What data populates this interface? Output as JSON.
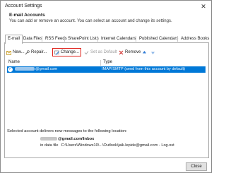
{
  "window": {
    "title": "Account Settings",
    "close_glyph": "✕"
  },
  "header": {
    "title": "E-mail Accounts",
    "description": "You can add or remove an account. You can select an account and change its settings."
  },
  "tabs": [
    {
      "label": "E-mail"
    },
    {
      "label": "Data Files"
    },
    {
      "label": "RSS Feeds"
    },
    {
      "label": "SharePoint Lists"
    },
    {
      "label": "Internet Calendars"
    },
    {
      "label": "Published Calendars"
    },
    {
      "label": "Address Books"
    }
  ],
  "toolbar": {
    "new_label": "New...",
    "repair_label": "Repair...",
    "change_label": "Change...",
    "set_default_label": "Set as Default",
    "remove_label": "Remove"
  },
  "list": {
    "col_name": "Name",
    "col_type": "Type",
    "rows": [
      {
        "name_suffix": "@gmail.com",
        "type": "IMAP/SMTP (send from this account by default)"
      }
    ]
  },
  "delivery": {
    "text": "Selected account delivers new messages to the following location:",
    "location_suffix": "@gmail.com\\Inbox",
    "data_file_label": "in data file",
    "data_file_path": "C:\\Users\\Windows10\\...\\Outlook\\jaik.lepide@gmail.com - Log.ost"
  },
  "footer": {
    "close_label": "Close"
  },
  "colors": {
    "selection": "#0078d7",
    "highlight_box": "#e0241d",
    "up_arrow": "#2e7bd6"
  }
}
